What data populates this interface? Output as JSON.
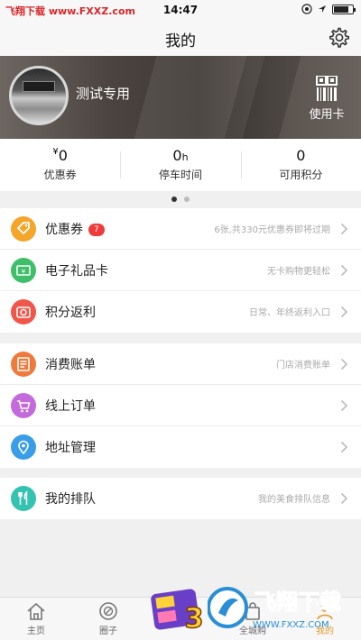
{
  "status_bar": {
    "watermark": "飞翔下载 www.FXXZ.com",
    "time": "14:47"
  },
  "header": {
    "title": "我的"
  },
  "profile": {
    "username": "测试专用",
    "card_label": "使用卡"
  },
  "stats": [
    {
      "prefix": "¥",
      "value": "0",
      "suffix": "",
      "label": "优惠券"
    },
    {
      "prefix": "",
      "value": "0",
      "suffix": "h",
      "label": "停车时间"
    },
    {
      "prefix": "",
      "value": "0",
      "suffix": "",
      "label": "可用积分"
    }
  ],
  "menu_group1": [
    {
      "name": "优惠券",
      "badge": "7",
      "hint": "6张,共330元优惠券即将过期",
      "color": "#f4a52a"
    },
    {
      "name": "电子礼品卡",
      "hint": "无卡购物更轻松",
      "color": "#3fbf6a"
    },
    {
      "name": "积分返利",
      "hint": "日常、年终返利入口",
      "color": "#f0574a"
    }
  ],
  "menu_group2": [
    {
      "name": "消费账单",
      "hint": "门店消费账单",
      "color": "#f07a3c"
    },
    {
      "name": "线上订单",
      "hint": "",
      "color": "#c36bdc"
    },
    {
      "name": "地址管理",
      "hint": "",
      "color": "#3a9de8"
    }
  ],
  "menu_group3": [
    {
      "name": "我的排队",
      "hint": "我的美食排队信息",
      "color": "#35c3b1"
    }
  ],
  "tabbar": [
    {
      "label": "主页",
      "icon": "home-icon"
    },
    {
      "label": "圈子",
      "icon": "circle-icon"
    },
    {
      "label": "",
      "icon": "promo"
    },
    {
      "label": "全城购",
      "icon": "shop-icon"
    },
    {
      "label": "我的",
      "icon": "user-icon"
    }
  ],
  "watermark_site": "WWW.FXXZ.COM",
  "watermark_brand": "飞翔下载"
}
